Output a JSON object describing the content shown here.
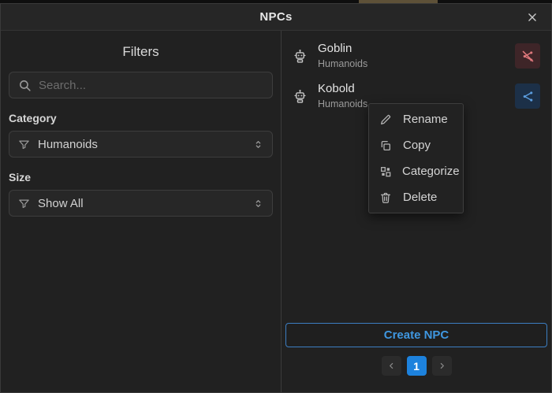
{
  "header": {
    "title": "NPCs",
    "close_icon": "close-icon"
  },
  "filters": {
    "title": "Filters",
    "search": {
      "placeholder": "Search...",
      "value": "",
      "icon": "search-icon"
    },
    "category": {
      "label": "Category",
      "value": "Humanoids",
      "icon": "filter-funnel-icon"
    },
    "size": {
      "label": "Size",
      "value": "Show All",
      "icon": "filter-funnel-icon"
    }
  },
  "npcs": {
    "items": [
      {
        "name": "Goblin",
        "category": "Humanoids",
        "icon": "robot-icon",
        "action_icon": "share-off-icon",
        "action_state": "unshared"
      },
      {
        "name": "Kobold",
        "category": "Humanoids",
        "icon": "robot-icon",
        "action_icon": "share-icon",
        "action_state": "shared"
      }
    ]
  },
  "context_menu": {
    "items": [
      {
        "label": "Rename",
        "icon": "pencil-icon"
      },
      {
        "label": "Copy",
        "icon": "copy-icon"
      },
      {
        "label": "Categorize",
        "icon": "grid-icon"
      },
      {
        "label": "Delete",
        "icon": "trash-icon"
      }
    ]
  },
  "footer": {
    "create_button_label": "Create NPC",
    "pagination": {
      "current_page": "1",
      "prev_icon": "chevron-left-icon",
      "next_icon": "chevron-right-icon"
    }
  },
  "colors": {
    "dialog_bg": "#212121",
    "header_bg": "#262626",
    "accent_blue": "#1d82dd",
    "button_border_blue": "#3c7ec2",
    "button_text_blue": "#3f97e0",
    "danger_red": "#df787c",
    "danger_bg": "#3e2528",
    "share_blue": "#5b9ddf",
    "share_bg": "#1c3048"
  }
}
